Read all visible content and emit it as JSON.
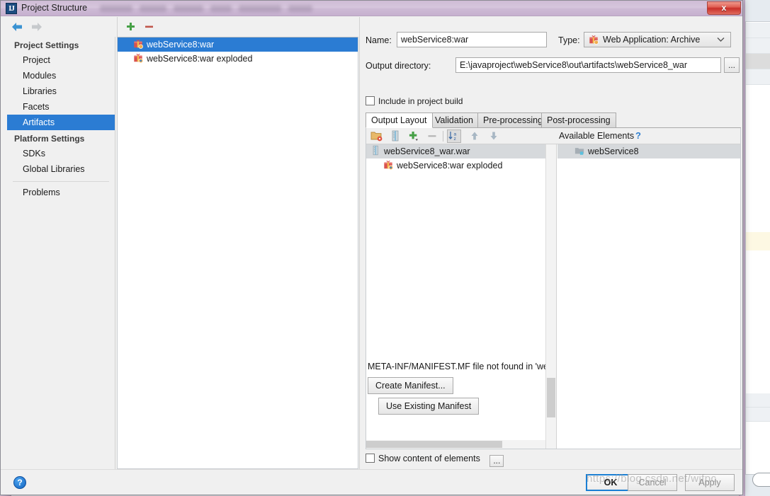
{
  "window": {
    "title": "Project Structure",
    "app_icon": "IJ",
    "close_label": "x"
  },
  "nav": {
    "back_icon": "arrow-left-icon",
    "forward_icon": "arrow-right-icon"
  },
  "sidebar": {
    "groups": [
      {
        "label": "Project Settings",
        "items": [
          {
            "label": "Project",
            "selected": false
          },
          {
            "label": "Modules",
            "selected": false
          },
          {
            "label": "Libraries",
            "selected": false
          },
          {
            "label": "Facets",
            "selected": false
          },
          {
            "label": "Artifacts",
            "selected": true
          }
        ]
      },
      {
        "label": "Platform Settings",
        "items": [
          {
            "label": "SDKs",
            "selected": false
          },
          {
            "label": "Global Libraries",
            "selected": false
          }
        ]
      }
    ],
    "problems": {
      "label": "Problems",
      "selected": false
    }
  },
  "artifacts_panel": {
    "toolbar": {
      "add_icon": "plus-icon",
      "remove_icon": "minus-icon"
    },
    "items": [
      {
        "label": "webService8:war",
        "icon": "artifact-archive-icon",
        "selected": true
      },
      {
        "label": "webService8:war exploded",
        "icon": "artifact-exploded-icon",
        "selected": false
      }
    ]
  },
  "details": {
    "name_label": "Name:",
    "name_value": "webService8:war",
    "type_label": "Type:",
    "type_value": "Web Application: Archive",
    "type_icon": "artifact-archive-icon",
    "output_dir_label": "Output directory:",
    "output_dir_value": "E:\\javaproject\\webService8\\out\\artifacts\\webService8_war",
    "browse_label": "...",
    "include_in_build_label": "Include in project build",
    "include_in_build_checked": false
  },
  "tabs": [
    {
      "label": "Output Layout",
      "active": true
    },
    {
      "label": "Validation",
      "active": false
    },
    {
      "label": "Pre-processing",
      "active": false
    },
    {
      "label": "Post-processing",
      "active": false
    }
  ],
  "layout_toolbar": {
    "icons": [
      {
        "name": "create-directory-icon"
      },
      {
        "name": "create-archive-icon"
      },
      {
        "name": "add-copy-icon"
      },
      {
        "name": "remove-icon"
      },
      {
        "name": "sort-alphabetically-icon"
      },
      {
        "name": "move-up-icon"
      },
      {
        "name": "move-down-icon"
      }
    ],
    "available_elements_label": "Available Elements",
    "help_label": "?"
  },
  "output_tree": [
    {
      "label": "webService8_war.war",
      "icon": "archive-icon",
      "indent": 0,
      "selected": true
    },
    {
      "label": "webService8:war exploded",
      "icon": "artifact-exploded-icon",
      "indent": 1,
      "selected": false
    }
  ],
  "available_elements": [
    {
      "label": "webService8",
      "icon": "module-icon",
      "selected": true
    }
  ],
  "manifest": {
    "message": "META-INF/MANIFEST.MF file not found in 'webSer",
    "create_label": "Create Manifest...",
    "use_existing_label": "Use Existing Manifest"
  },
  "show_content": {
    "label": "Show content of elements",
    "checked": false,
    "browse_label": "..."
  },
  "footer": {
    "help_label": "?",
    "ok_label": "OK",
    "cancel_label": "Cancel",
    "apply_label": "Apply"
  },
  "watermark": "https://blog.csdn.net/wjfpc",
  "colors": {
    "accent": "#2b7cd3",
    "title_bar": "#cdbad5",
    "close_red": "#c9302a",
    "panel_bg": "#f0f0f0",
    "selection_gray": "#d6d9dc"
  }
}
